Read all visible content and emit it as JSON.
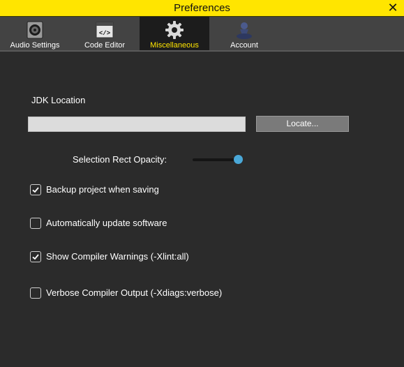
{
  "window": {
    "title": "Preferences",
    "title_bar_color": "#ffe500"
  },
  "tabs": [
    {
      "label": "Audio Settings",
      "icon": "speaker-icon",
      "active": false
    },
    {
      "label": "Code Editor",
      "icon": "code-window-icon",
      "active": false
    },
    {
      "label": "Miscellaneous",
      "icon": "gear-icon",
      "active": true
    },
    {
      "label": "Account",
      "icon": "user-icon",
      "active": false
    }
  ],
  "misc": {
    "jdk_label": "JDK Location",
    "jdk_value": "",
    "locate_button": "Locate...",
    "opacity_label": "Selection Rect Opacity:",
    "opacity_value": 1.0,
    "checkboxes": [
      {
        "label": "Backup project when saving",
        "checked": true
      },
      {
        "label": "Automatically update software",
        "checked": false
      },
      {
        "label": "Show Compiler Warnings (-Xlint:all)",
        "checked": true
      },
      {
        "label": "Verbose Compiler Output (-Xdiags:verbose)",
        "checked": false
      }
    ]
  },
  "colors": {
    "accent": "#ffe500",
    "slider_thumb": "#4aa8d8",
    "background": "#2b2b2b"
  }
}
